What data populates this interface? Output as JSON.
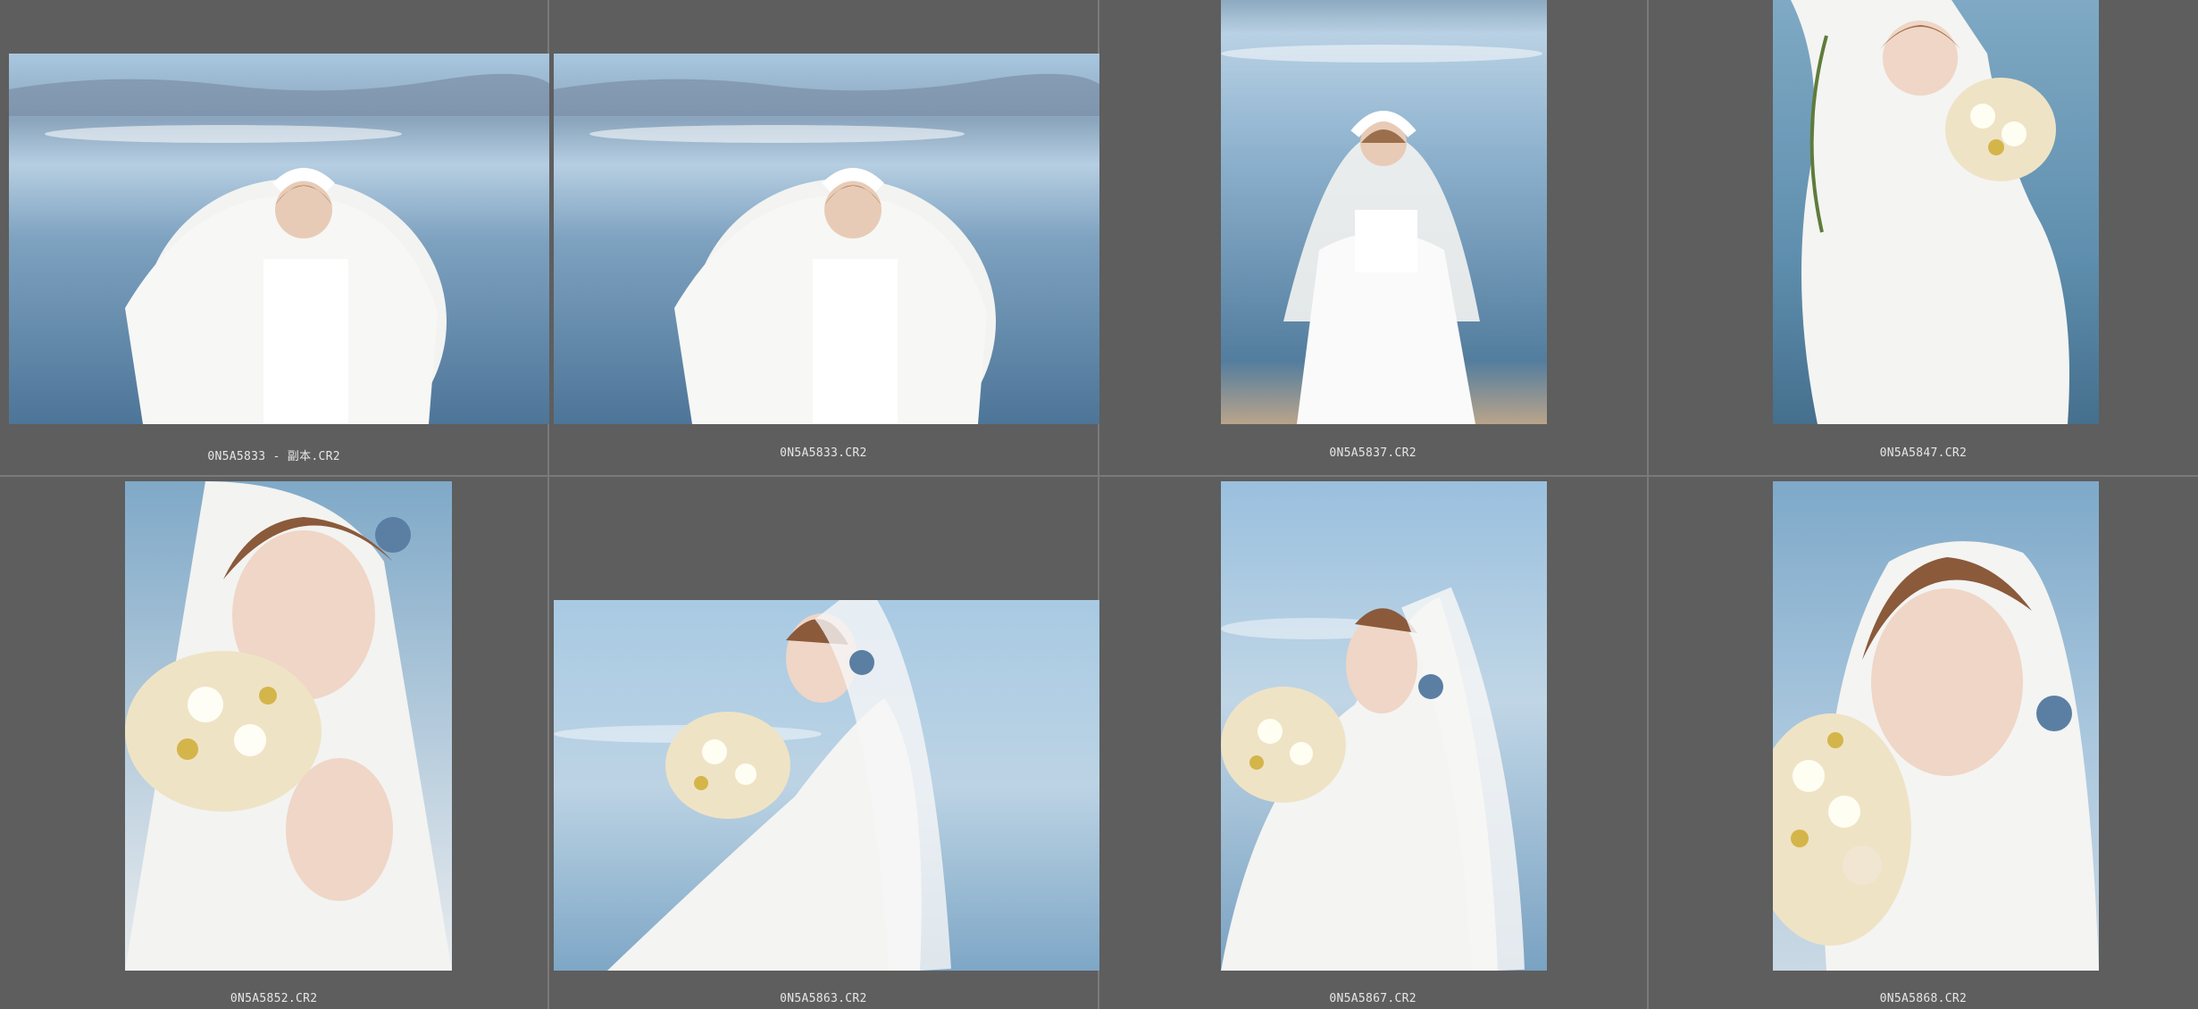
{
  "photos": [
    {
      "filename": "0N5A5833 - 副本.CR2",
      "orientation": "landscape",
      "subject": "bride-hands-open-lake"
    },
    {
      "filename": "0N5A5833.CR2",
      "orientation": "landscape",
      "subject": "bride-hands-open-lake"
    },
    {
      "filename": "0N5A5837.CR2",
      "orientation": "portrait",
      "subject": "bride-standing-lake"
    },
    {
      "filename": "0N5A5847.CR2",
      "orientation": "portrait",
      "subject": "bride-bouquet-side"
    },
    {
      "filename": "0N5A5852.CR2",
      "orientation": "portrait",
      "subject": "bride-bouquet-closeup"
    },
    {
      "filename": "0N5A5863.CR2",
      "orientation": "landscape",
      "subject": "bride-bouquet-profile"
    },
    {
      "filename": "0N5A5867.CR2",
      "orientation": "portrait",
      "subject": "bride-bouquet-profile"
    },
    {
      "filename": "0N5A5868.CR2",
      "orientation": "portrait",
      "subject": "bride-bouquet-closeup"
    }
  ],
  "colors": {
    "background": "#5e5e5e",
    "divider": "#7a7a7a",
    "caption": "#e6e6e6",
    "sky": "#9cc0dc",
    "water": "#5f88a8",
    "dress": "#f4f4f2"
  }
}
